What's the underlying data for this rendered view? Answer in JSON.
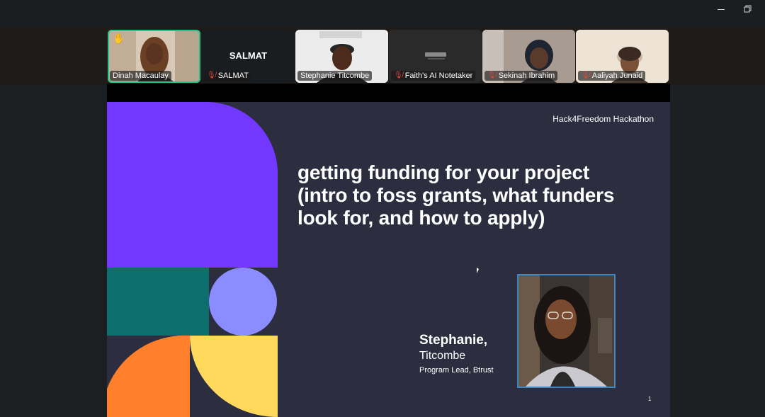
{
  "participants": [
    {
      "name": "Dinah Macaulay",
      "muted": false,
      "active": true,
      "hand_raised": true
    },
    {
      "name": "SALMAT",
      "muted": true,
      "display": "SALMAT"
    },
    {
      "name": "Stephanie Titcombe",
      "muted": false
    },
    {
      "name": "Faith's AI Notetaker",
      "muted": true
    },
    {
      "name": "Sekinah Ibrahim",
      "muted": true
    },
    {
      "name": "Aaliyah Junaid",
      "muted": true
    }
  ],
  "slide": {
    "header": "Hack4Freedom Hackathon",
    "title_lines": [
      "getting funding for your project",
      "(intro to foss grants, what funders",
      "look for, and how to apply)"
    ],
    "speaker_first": "Stephanie,",
    "speaker_last": "Titcombe",
    "speaker_role": "Program Lead, Btrust",
    "page_number": "1"
  },
  "icons": {
    "minimize": "minimize-icon",
    "restore": "restore-icon",
    "mute": "mic-muted-icon",
    "hand": "raised-hand-icon"
  },
  "colors": {
    "active_border": "#27c48a",
    "mute_red": "#e0473f",
    "slide_bg": "#2d2d40",
    "purple": "#7338ff",
    "teal": "#0d6e6e",
    "periwinkle": "#8b8cff",
    "orange": "#ff7f2a",
    "yellow": "#ffd95c"
  }
}
